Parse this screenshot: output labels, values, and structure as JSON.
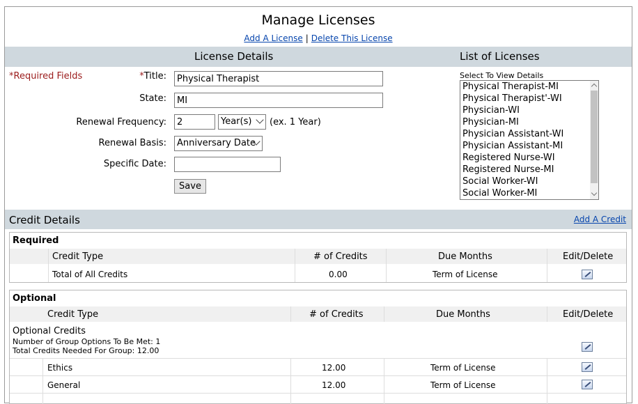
{
  "header": {
    "title": "Manage Licenses",
    "add_license": "Add A License",
    "separator": "|",
    "delete_license": "Delete This License"
  },
  "license_details": {
    "section_title": "License Details",
    "required_note": "*Required Fields",
    "title_star": "*",
    "title_label": "Title:",
    "title_value": "Physical Therapist",
    "state_label": "State:",
    "state_value": "MI",
    "renewal_frequency_label": "Renewal Frequency:",
    "renewal_frequency_value": "2",
    "renewal_unit": "Year(s)",
    "renewal_example": "(ex. 1 Year)",
    "renewal_basis_label": "Renewal Basis:",
    "renewal_basis_value": "Anniversary Date",
    "specific_date_label": "Specific Date:",
    "specific_date_value": "",
    "save_label": "Save"
  },
  "licenses_list": {
    "section_title": "List of Licenses",
    "select_label": "Select To View Details",
    "items": [
      "Physical Therapist-MI",
      "Physical Therapist'-WI",
      "Physician-WI",
      "Physician-MI",
      "Physician Assistant-WI",
      "Physician Assistant-MI",
      "Registered Nurse-WI",
      "Registered Nurse-MI",
      "Social Worker-WI",
      "Social Worker-MI"
    ]
  },
  "credit_details": {
    "section_title": "Credit Details",
    "add_credit": "Add A Credit",
    "required": {
      "title": "Required",
      "columns": [
        "Credit Type",
        "# of Credits",
        "Due Months",
        "Edit/Delete"
      ],
      "rows": [
        {
          "type": "Total of All Credits",
          "credits": "0.00",
          "due": "Term of License"
        }
      ]
    },
    "optional": {
      "title": "Optional",
      "columns": [
        "Credit Type",
        "# of Credits",
        "Due Months",
        "Edit/Delete"
      ],
      "group_name": "Optional Credits",
      "group_line1": "Number of Group Options To Be Met: 1",
      "group_line2": "Total Credits Needed For Group: 12.00",
      "rows": [
        {
          "type": "Ethics",
          "credits": "12.00",
          "due": "Term of License"
        },
        {
          "type": "General",
          "credits": "12.00",
          "due": "Term of License"
        }
      ]
    }
  }
}
